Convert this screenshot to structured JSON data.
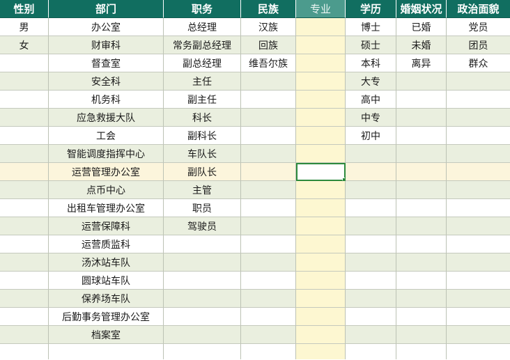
{
  "headers": [
    "性别",
    "部门",
    "职务",
    "民族",
    "专业",
    "学历",
    "婚姻状况",
    "政治面貌"
  ],
  "rows": [
    [
      "男",
      "办公室",
      "总经理",
      "汉族",
      "",
      "博士",
      "已婚",
      "党员"
    ],
    [
      "女",
      "财审科",
      "常务副总经理",
      "回族",
      "",
      "硕士",
      "未婚",
      "团员"
    ],
    [
      "",
      "督查室",
      "副总经理",
      "维吾尔族",
      "",
      "本科",
      "离异",
      "群众"
    ],
    [
      "",
      "安全科",
      "主任",
      "",
      "",
      "大专",
      "",
      ""
    ],
    [
      "",
      "机务科",
      "副主任",
      "",
      "",
      "高中",
      "",
      ""
    ],
    [
      "",
      "应急救援大队",
      "科长",
      "",
      "",
      "中专",
      "",
      ""
    ],
    [
      "",
      "工会",
      "副科长",
      "",
      "",
      "初中",
      "",
      ""
    ],
    [
      "",
      "智能调度指挥中心",
      "车队长",
      "",
      "",
      "",
      "",
      ""
    ],
    [
      "",
      "运营管理办公室",
      "副队长",
      "",
      "",
      "",
      "",
      ""
    ],
    [
      "",
      "点币中心",
      "主管",
      "",
      "",
      "",
      "",
      ""
    ],
    [
      "",
      "出租车管理办公室",
      "职员",
      "",
      "",
      "",
      "",
      ""
    ],
    [
      "",
      "运营保障科",
      "驾驶员",
      "",
      "",
      "",
      "",
      ""
    ],
    [
      "",
      "运营质监科",
      "",
      "",
      "",
      "",
      "",
      ""
    ],
    [
      "",
      "汤沐站车队",
      "",
      "",
      "",
      "",
      "",
      ""
    ],
    [
      "",
      "圆球站车队",
      "",
      "",
      "",
      "",
      "",
      ""
    ],
    [
      "",
      "保养场车队",
      "",
      "",
      "",
      "",
      "",
      ""
    ],
    [
      "",
      "后勤事务管理办公室",
      "",
      "",
      "",
      "",
      "",
      ""
    ],
    [
      "",
      "档案室",
      "",
      "",
      "",
      "",
      "",
      ""
    ],
    [
      "",
      "",
      "",
      "",
      "",
      "",
      "",
      ""
    ]
  ],
  "colors": {
    "header_bg": "#116e60",
    "header_selected_bg": "#4c9b8d",
    "row_alt_bg": "#eaefdf",
    "selected_column_bg": "#fdf7d1",
    "selection_border": "#2d8a3d"
  }
}
